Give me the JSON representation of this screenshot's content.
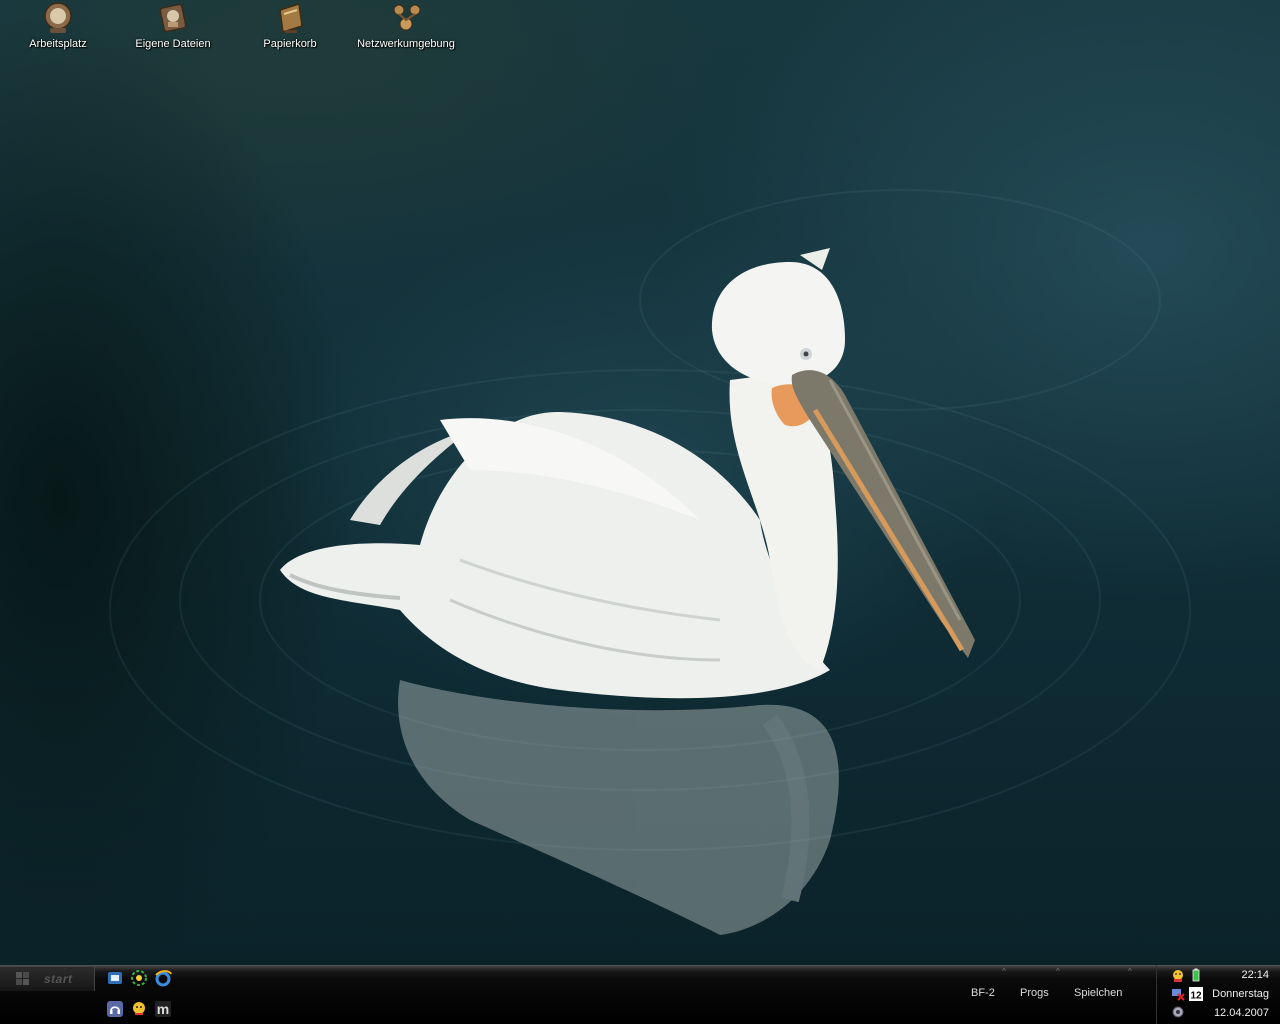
{
  "desktop": {
    "icons": [
      {
        "label": "Arbeitsplatz",
        "icon": "computer-icon"
      },
      {
        "label": "Eigene Dateien",
        "icon": "documents-icon"
      },
      {
        "label": "Papierkorb",
        "icon": "recycle-bin-icon"
      },
      {
        "label": "Netzwerkumgebung",
        "icon": "network-icon"
      }
    ]
  },
  "taskbar": {
    "start_label": "start",
    "quicklaunch": [
      "outlook-icon",
      "media-icon",
      "ie-icon",
      "headphones-icon",
      "messenger-icon",
      "m-icon"
    ],
    "toolbars": [
      {
        "label": "BF-2"
      },
      {
        "label": "Progs"
      },
      {
        "label": "Spielchen"
      }
    ],
    "tray": {
      "time": "22:14",
      "day": "Donnerstag",
      "date": "12.04.2007",
      "calendar_badge": "12",
      "icons": [
        "messenger-tray-icon",
        "battery-tray-icon",
        "network-error-tray-icon",
        "calendar-tray-icon",
        "speaker-tray-icon"
      ]
    }
  }
}
